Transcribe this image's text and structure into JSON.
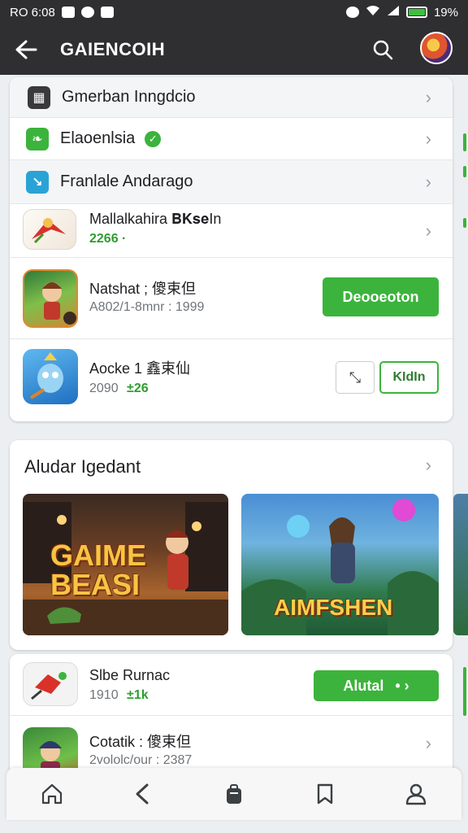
{
  "statusbar": {
    "left_text": "RO 6:08",
    "battery_text": "19%"
  },
  "appbar": {
    "title": "GAIENCOIH"
  },
  "list": {
    "rows": [
      {
        "label": "Gmerban Inngdcio",
        "icon": "store-icon"
      },
      {
        "label": "Elaoenlsia",
        "icon": "leaf-icon"
      },
      {
        "label": "Franlale Andarago",
        "icon": "arrow-box-icon"
      }
    ],
    "apps": [
      {
        "title": "Mallalkahira 𝐁𝐊𝐬𝐞In",
        "sub": "2266 ·"
      },
      {
        "title": "Natshat ; 傻束但",
        "sub": "A802/1-8mnr : 1999",
        "button": "Deooeoton"
      },
      {
        "title": "Aocke 1 鑫束仙",
        "sub": "2090",
        "sub_green": "±26",
        "button": "KIdIn"
      }
    ]
  },
  "section": {
    "title": "Aludar Igedant",
    "banners": [
      "GAIME BEASI",
      "AIMFSHEN"
    ]
  },
  "more": {
    "apps": [
      {
        "title": "Slbe Rurnac",
        "sub": "1910",
        "sub_green": "±1k",
        "button": "Alutal"
      },
      {
        "title": "Cotatik : 傻束但",
        "sub": "2vololc/our : 2387"
      }
    ]
  },
  "colors": {
    "accent": "#3cb33c",
    "appbar": "#2f2f31"
  }
}
